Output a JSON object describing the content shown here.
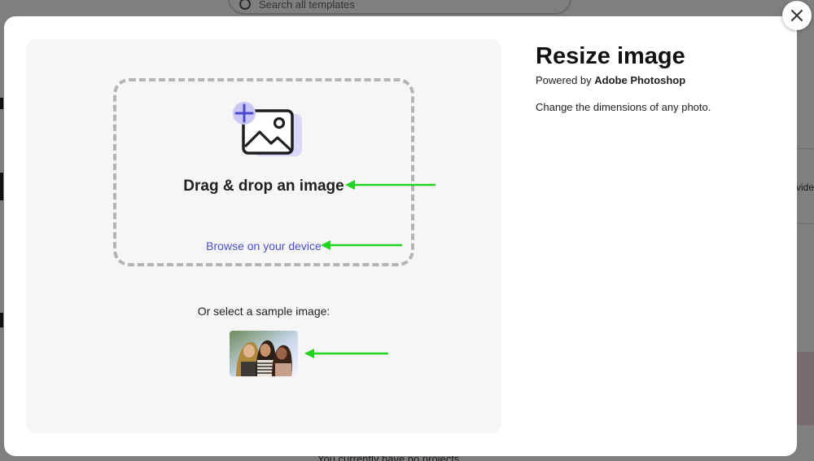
{
  "background": {
    "search_placeholder": "Search all templates",
    "side_text": "vide",
    "bottom_text": "You currently have no projects"
  },
  "modal": {
    "title": "Resize image",
    "powered_prefix": "Powered by ",
    "powered_brand": "Adobe Photoshop",
    "description": "Change the dimensions of any photo.",
    "drop_title": "Drag & drop an image",
    "browse_label": "Browse on your device",
    "sample_label": "Or select a sample image:"
  },
  "icons": {
    "close": "close-icon",
    "upload_art": "image-add-icon",
    "search": "search-icon"
  },
  "colors": {
    "accent_link": "#4c4ec9",
    "annotation_arrow": "#22d422",
    "panel_bg": "#f6f6f6",
    "dashed_border": "#b4b4b4"
  }
}
